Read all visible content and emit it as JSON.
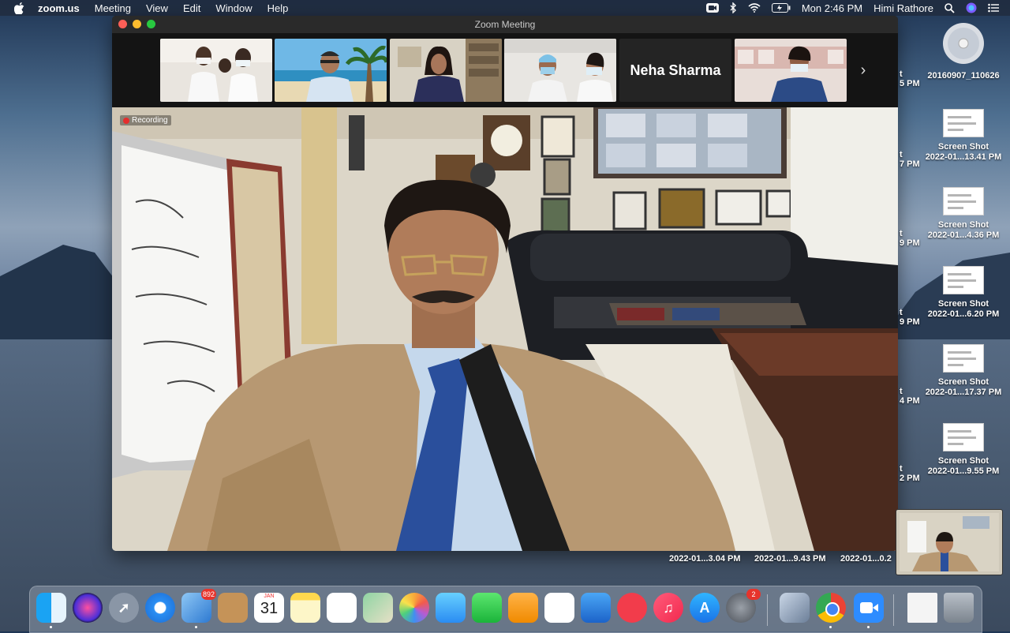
{
  "menubar": {
    "app_name": "zoom.us",
    "menus": [
      "Meeting",
      "View",
      "Edit",
      "Window",
      "Help"
    ],
    "clock": "Mon 2:46 PM",
    "user": "Himi Rathore"
  },
  "window": {
    "title": "Zoom Meeting",
    "recording_label": "Recording",
    "gallery": [
      {
        "type": "video",
        "icon": "participant-video"
      },
      {
        "type": "video",
        "icon": "participant-video"
      },
      {
        "type": "video",
        "icon": "participant-video"
      },
      {
        "type": "video",
        "icon": "participant-video"
      },
      {
        "type": "name",
        "name": "Neha Sharma"
      },
      {
        "type": "video",
        "icon": "participant-video"
      }
    ],
    "next_label": "›"
  },
  "desktop": {
    "disc": {
      "label": "20160907_110626"
    },
    "screenshots": [
      {
        "line1": "Screen Shot",
        "line2": "2022-01...13.41 PM"
      },
      {
        "line1": "Screen Shot",
        "line2": "2022-01...4.36 PM"
      },
      {
        "line1": "Screen Shot",
        "line2": "2022-01...6.20 PM"
      },
      {
        "line1": "Screen Shot",
        "line2": "2022-01...17.37 PM"
      },
      {
        "line1": "Screen Shot",
        "line2": "2022-01...9.55 PM"
      }
    ],
    "cut_labels": [
      {
        "a": "t",
        "b": "5 PM"
      },
      {
        "a": "t",
        "b": "7 PM"
      },
      {
        "a": "t",
        "b": "9 PM"
      },
      {
        "a": "t",
        "b": "9 PM"
      },
      {
        "a": "t",
        "b": "4 PM"
      },
      {
        "a": "t",
        "b": "2 PM"
      }
    ],
    "bottom_labels": [
      "2022-01...3.04 PM",
      "2022-01...9.43 PM",
      "2022-01...0.2"
    ]
  },
  "dock": {
    "mail_badge": "892",
    "calendar_month": "JAN",
    "calendar_day": "31",
    "settings_badge": "2",
    "apps": [
      "finder",
      "siri",
      "launchpad",
      "safari",
      "mail",
      "contacts",
      "calendar",
      "notes",
      "reminders",
      "maps",
      "photos",
      "messages",
      "facetime",
      "pages",
      "numbers",
      "keynote",
      "news",
      "music",
      "app-store",
      "system-preferences",
      "preview",
      "chrome",
      "zoom",
      "pdf-document",
      "trash"
    ]
  },
  "colors": {
    "zoom_blue": "#2d8cff",
    "record_red": "#e52d2d",
    "badge_red": "#e6342c"
  }
}
